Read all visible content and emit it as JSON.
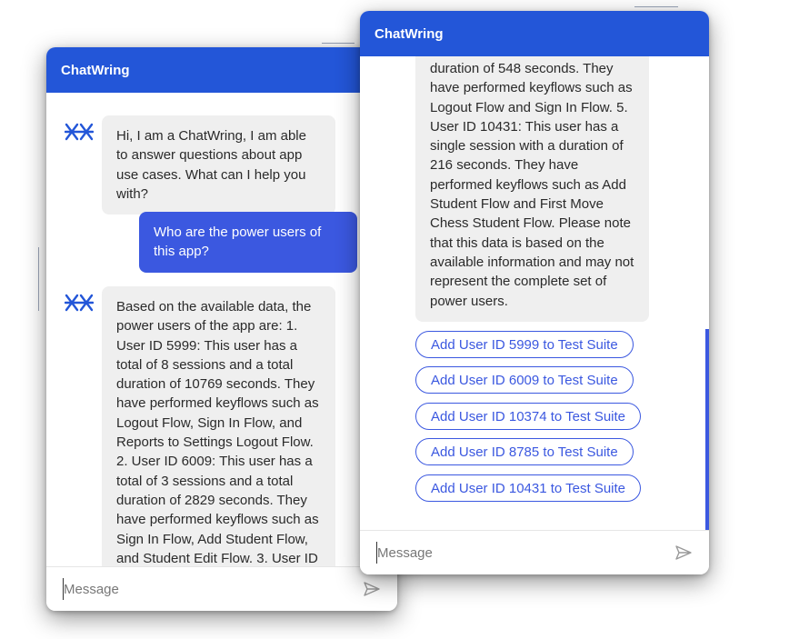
{
  "colors": {
    "header": "#2356d8",
    "user_bubble": "#3b58e0",
    "bot_bubble": "#efefef",
    "accent": "#3b58e0"
  },
  "window_left": {
    "title": "ChatWring",
    "greeting": "Hi, I am a ChatWring, I am able to answer questions about app use cases. What can I help you with?",
    "user_question": "Who are the power users of this app?",
    "bot_answer": "Based on the available data, the power users of the app are: 1. User ID 5999: This user has a total of 8 sessions and a total duration of 10769 seconds. They have performed keyflows such as Logout Flow, Sign In Flow, and Reports to Settings Logout Flow. 2. User ID 6009: This user has a total of 3 sessions and a total duration of 2829 seconds. They have performed keyflows such as Sign In Flow, Add Student Flow, and Student Edit Flow. 3. User ID",
    "input_placeholder": "Message",
    "bot_icon": "logo-icon",
    "send_icon": "send-icon"
  },
  "window_right": {
    "title": "ChatWring",
    "bot_answer_tail": "duration of 548 seconds. They have performed keyflows such as Logout Flow and Sign In Flow. 5. User ID 10431: This user has a single session with a duration of 216 seconds. They have performed keyflows such as Add Student Flow and First Move Chess Student Flow. Please note that this data is based on the available information and may not represent the complete set of power users.",
    "actions": [
      "Add User ID 5999 to Test Suite",
      "Add User ID 6009 to Test Suite",
      "Add User ID 10374 to Test Suite",
      "Add User ID 8785 to Test Suite",
      "Add User ID 10431 to Test Suite"
    ],
    "input_placeholder": "Message",
    "send_icon": "send-icon"
  }
}
